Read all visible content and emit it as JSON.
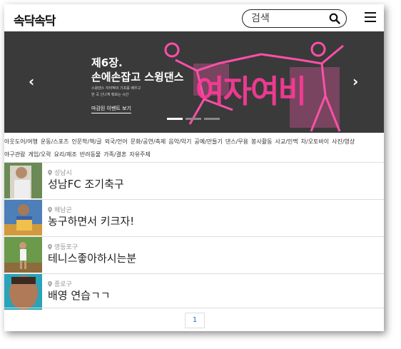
{
  "header": {
    "logo": "속닥속닥",
    "search_placeholder": "검색"
  },
  "banner": {
    "title_line1": "제6장.",
    "title_line2": "손에손잡고 스윙댄스",
    "desc_line1": "스윙댄스 지터벅의 기초를 배우고",
    "desc_line2": "한 곡 신나게 춰보는 시간",
    "cta": "마감된 이벤트 보기",
    "big_text": "여자여비",
    "active_slide": 1,
    "slide_count": 3
  },
  "categories": {
    "row1": [
      "아웃도어/여행",
      "운동/스포츠",
      "인문학/책/글",
      "외국/언어",
      "문화/공연/축제",
      "음악/악기",
      "공예/만들기",
      "댄스/무용",
      "봉사활동",
      "사교/인맥",
      "차/오토바이",
      "사진/영상"
    ],
    "row2": [
      "야구관람",
      "게임/오락",
      "요리/제조",
      "반려동물",
      "가족/결혼",
      "자유주제"
    ]
  },
  "posts": [
    {
      "location": "성남시",
      "title": "성남FC 조기축구"
    },
    {
      "location": "해남군",
      "title": "농구하면서 키크자!"
    },
    {
      "location": "영등포구",
      "title": "테니스좋아하시는분"
    },
    {
      "location": "종로구",
      "title": "배영 연습ㄱㄱ"
    }
  ],
  "pagination": {
    "current": "1"
  },
  "colors": {
    "accent": "#ff3a9a",
    "link": "#2a6ebb"
  }
}
